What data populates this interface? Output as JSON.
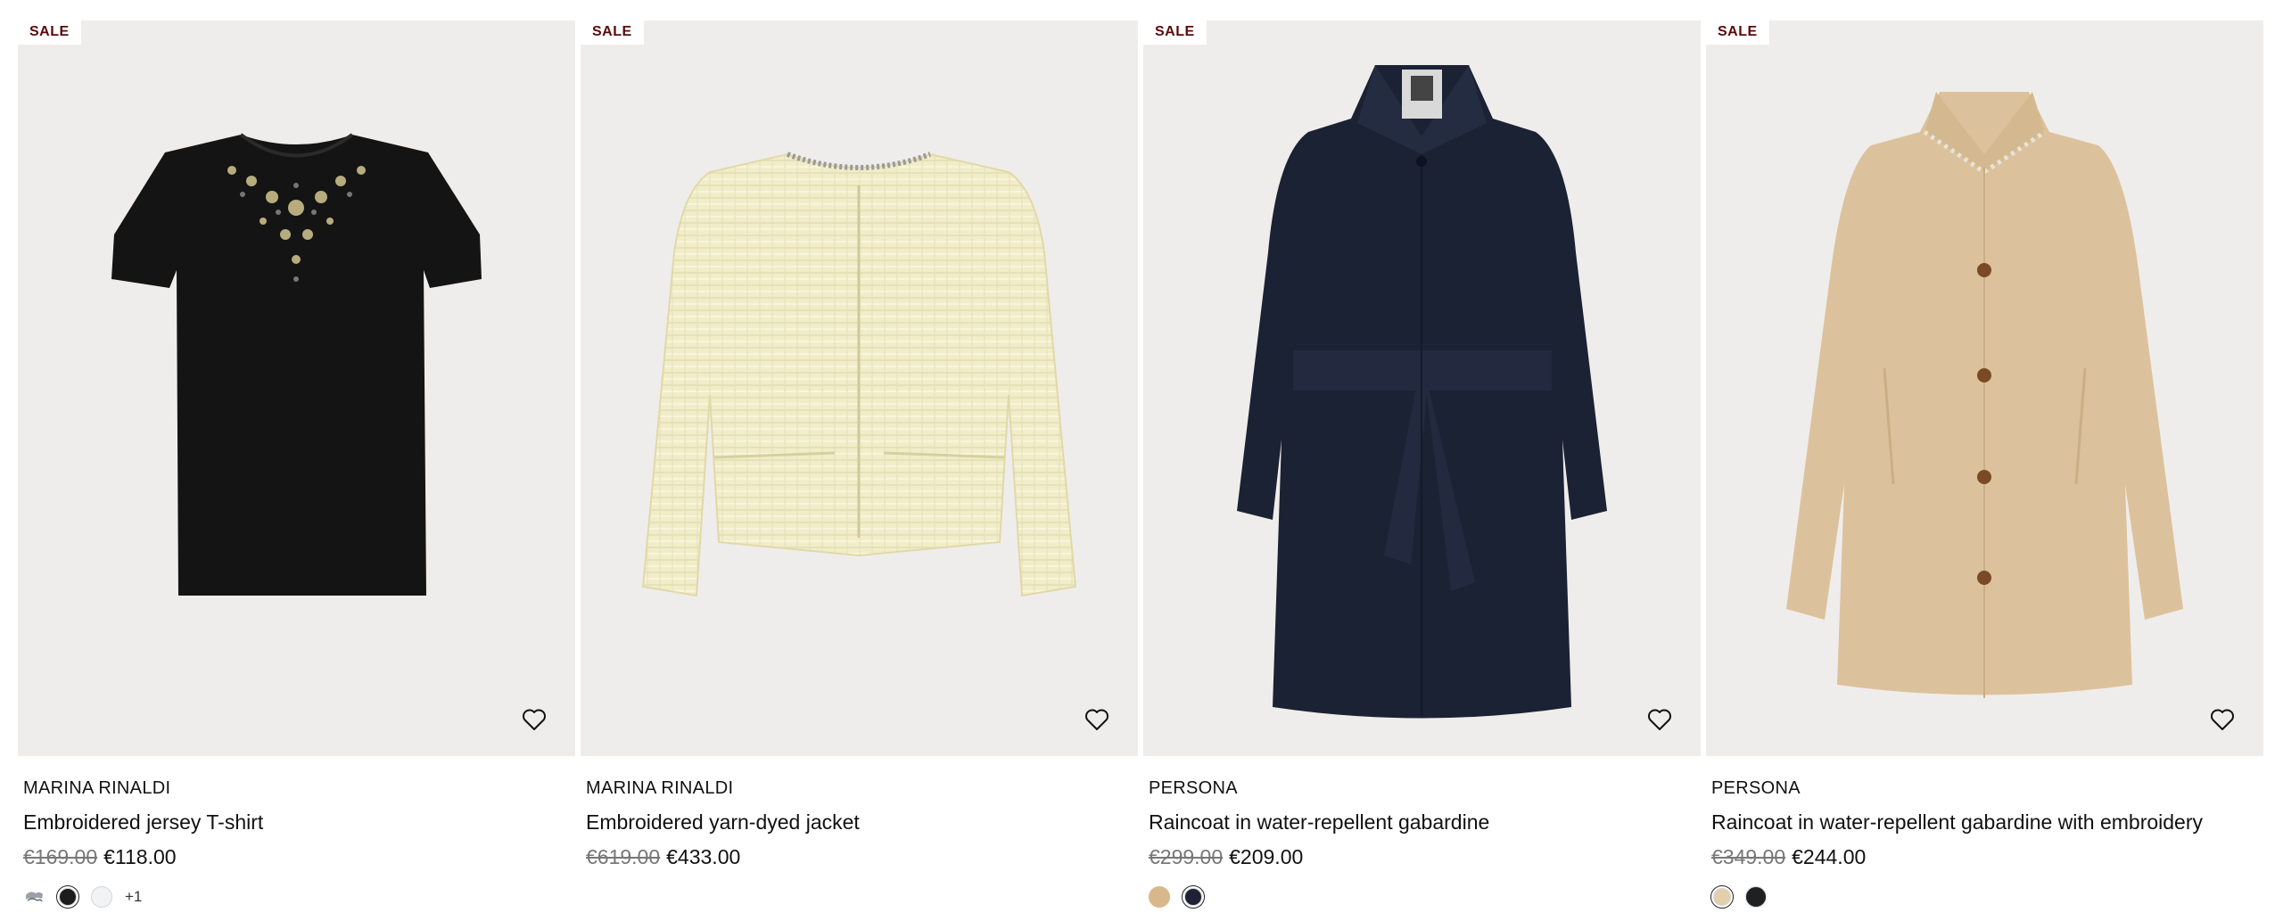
{
  "products": [
    {
      "badge": "SALE",
      "brand": "MARINA RINALDI",
      "name": "Embroidered jersey T-shirt",
      "old_price": "€169.00",
      "new_price": "€118.00",
      "garment": "tshirt",
      "swatches": [
        "pattern",
        "#1c1c1c",
        "#f2f3f5"
      ],
      "more_colors": "+1"
    },
    {
      "badge": "SALE",
      "brand": "MARINA RINALDI",
      "name": "Embroidered yarn-dyed jacket",
      "old_price": "€619.00",
      "new_price": "€433.00",
      "garment": "jacket",
      "swatches": [],
      "more_colors": ""
    },
    {
      "badge": "SALE",
      "brand": "PERSONA",
      "name": "Raincoat in water-repellent gabardine",
      "old_price": "€299.00",
      "new_price": "€209.00",
      "garment": "navy-coat",
      "swatches": [
        "#d8b88a",
        "#1d2236"
      ],
      "more_colors": ""
    },
    {
      "badge": "SALE",
      "brand": "PERSONA",
      "name": "Raincoat in water-repellent gabardine with embroidery",
      "old_price": "€349.00",
      "new_price": "€244.00",
      "garment": "beige-coat",
      "swatches": [
        "#e3cfac",
        "#1e2022"
      ],
      "more_colors": ""
    }
  ],
  "icons": {
    "wishlist": "heart-outline-icon"
  },
  "colors": {
    "image_bg": "#efedeb",
    "sale_text": "#5b0a0a",
    "old_price": "#777777"
  }
}
